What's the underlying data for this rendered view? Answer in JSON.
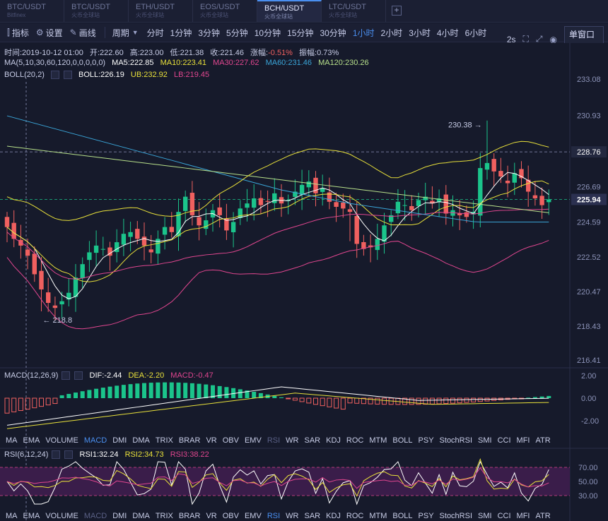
{
  "tabs": [
    {
      "pair": "BTC/USDT",
      "sub": "Bitfinex",
      "active": false
    },
    {
      "pair": "BTC/USDT",
      "sub": "火币全球站",
      "active": false
    },
    {
      "pair": "ETH/USDT",
      "sub": "火币全球站",
      "active": false
    },
    {
      "pair": "EOS/USDT",
      "sub": "火币全球站",
      "active": false
    },
    {
      "pair": "BCH/USDT",
      "sub": "火币全球站",
      "active": true
    },
    {
      "pair": "LTC/USDT",
      "sub": "火币全球站",
      "active": false
    }
  ],
  "toolbar": {
    "indicator_label": "指标",
    "settings_label": "设置",
    "draw_label": "画线",
    "period_label": "周期",
    "periods": [
      "分时",
      "1分钟",
      "3分钟",
      "5分钟",
      "10分钟",
      "15分钟",
      "30分钟",
      "1小时",
      "2小时",
      "3小时",
      "4小时",
      "6小时"
    ],
    "active_period": "1小时",
    "interval": "2s",
    "window_mode": "单窗口"
  },
  "info": {
    "time": "时间:2019-10-12 01:00",
    "open": "开:222.60",
    "high": "高:223.00",
    "low": "低:221.38",
    "close": "收:221.46",
    "change_label": "涨幅:",
    "change": "-0.51%",
    "amplitude": "振幅:0.73%"
  },
  "ma_legend": {
    "title": "MA(5,10,30,60,120,0,0,0,0,0)",
    "ma5": "MA5:222.85",
    "ma10": "MA10:223.41",
    "ma30": "MA30:227.62",
    "ma60": "MA60:231.46",
    "ma120": "MA120:230.26"
  },
  "boll_legend": {
    "title": "BOLL(20,2)",
    "boll": "BOLL:226.19",
    "ub": "UB:232.92",
    "lb": "LB:219.45"
  },
  "price_axis": [
    "233.08",
    "230.93",
    "228.76",
    "226.69",
    "225.94",
    "224.59",
    "222.52",
    "220.47",
    "218.43",
    "216.41"
  ],
  "annotations": {
    "high": "230.38",
    "low": "218.8",
    "dashed_level": "228.76",
    "last_price": "225.94"
  },
  "macd_legend": {
    "title": "MACD(12,26,9)",
    "dif": "DIF:-2.44",
    "dea": "DEA:-2.20",
    "macd": "MACD:-0.47"
  },
  "macd_axis": [
    "2.00",
    "0.00",
    "-2.00"
  ],
  "indicator_tabs_1": [
    "MA",
    "EMA",
    "VOLUME",
    "MACD",
    "DMI",
    "DMA",
    "TRIX",
    "BRAR",
    "VR",
    "OBV",
    "EMV",
    "RSI",
    "WR",
    "SAR",
    "KDJ",
    "ROC",
    "MTM",
    "BOLL",
    "PSY",
    "StochRSI",
    "SMI",
    "CCI",
    "MFI",
    "ATR"
  ],
  "indicator_tabs_1_active": "MACD",
  "indicator_tabs_1_dim": "RSI",
  "rsi_legend": {
    "title": "RSI(6,12,24)",
    "rsi1": "RSI1:32.24",
    "rsi2": "RSI2:34.73",
    "rsi3": "RSI3:38.22"
  },
  "rsi_axis": [
    "70.00",
    "50.00",
    "30.00"
  ],
  "indicator_tabs_2": [
    "MA",
    "EMA",
    "VOLUME",
    "MACD",
    "DMI",
    "DMA",
    "TRIX",
    "BRAR",
    "VR",
    "OBV",
    "EMV",
    "RSI",
    "WR",
    "SAR",
    "KDJ",
    "ROC",
    "MTM",
    "BOLL",
    "PSY",
    "StochRSI",
    "SMI",
    "CCI",
    "MFI",
    "ATR"
  ],
  "indicator_tabs_2_active": "RSI",
  "indicator_tabs_2_dim": "MACD",
  "colors": {
    "up": "#1bc48b",
    "down": "#f0605f",
    "ma5": "#ffffff",
    "ma10": "#e8e03a",
    "ma30": "#e0468f",
    "ma60": "#3aa5d8",
    "ma120": "#b7e08a",
    "accent": "#4a8ff0"
  }
}
